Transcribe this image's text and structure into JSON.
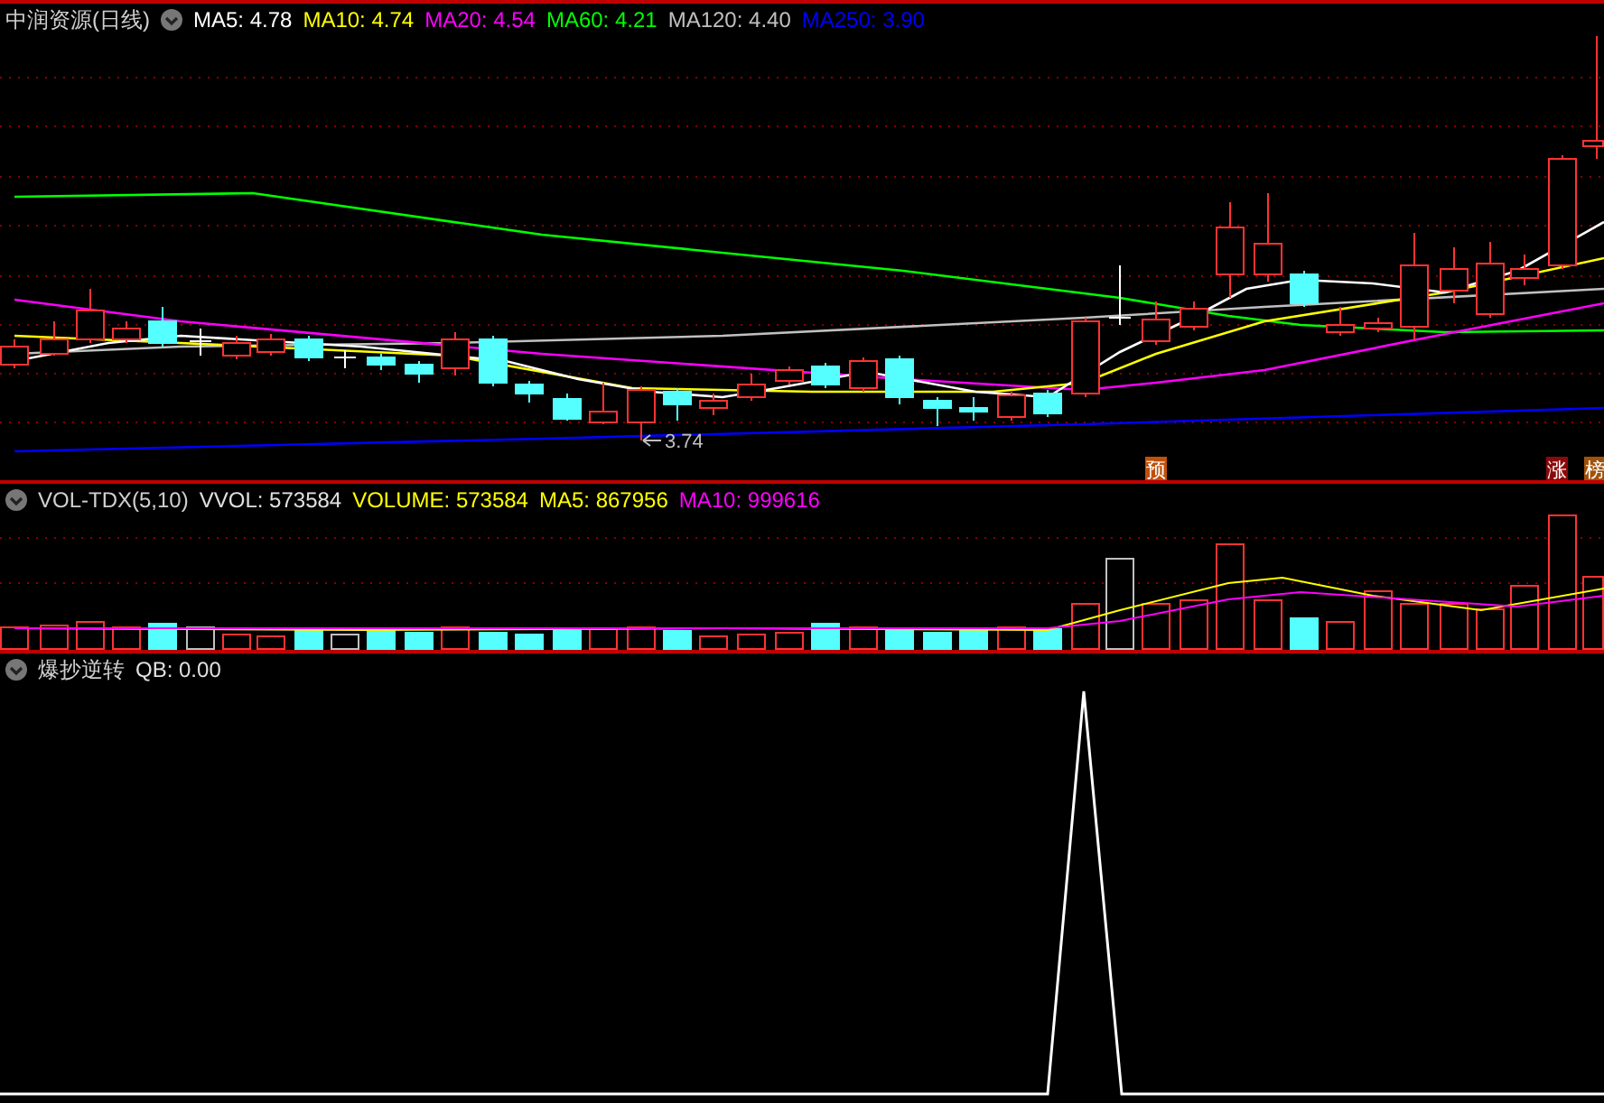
{
  "main_chart": {
    "title": "中润资源(日线)",
    "indicators": [
      {
        "label": "MA5: 4.78",
        "color": "#ffffff"
      },
      {
        "label": "MA10: 4.74",
        "color": "#ffff00"
      },
      {
        "label": "MA20: 4.54",
        "color": "#ff00ff"
      },
      {
        "label": "MA60: 4.21",
        "color": "#00ff00"
      },
      {
        "label": "MA120: 4.40",
        "color": "#c0c0c0"
      },
      {
        "label": "MA250: 3.90",
        "color": "#0000ff"
      }
    ],
    "low_marker": "3.74",
    "badges": [
      {
        "text": "预",
        "color": "#c0500a"
      },
      {
        "text": "涨",
        "color": "#8a0a0a"
      },
      {
        "text": "榜",
        "color": "#a0520a"
      }
    ]
  },
  "volume_chart": {
    "title": "VOL-TDX(5,10)",
    "indicators": [
      {
        "label": "VVOL: 573584",
        "color": "#e0e0e0"
      },
      {
        "label": "VOLUME: 573584",
        "color": "#ffff00"
      },
      {
        "label": "MA5: 867956",
        "color": "#ffff00"
      },
      {
        "label": "MA10: 999616",
        "color": "#ff00ff"
      }
    ]
  },
  "signal_chart": {
    "title": "爆抄逆转",
    "indicators": [
      {
        "label": "QB: 0.00",
        "color": "#e0e0e0"
      }
    ]
  }
}
